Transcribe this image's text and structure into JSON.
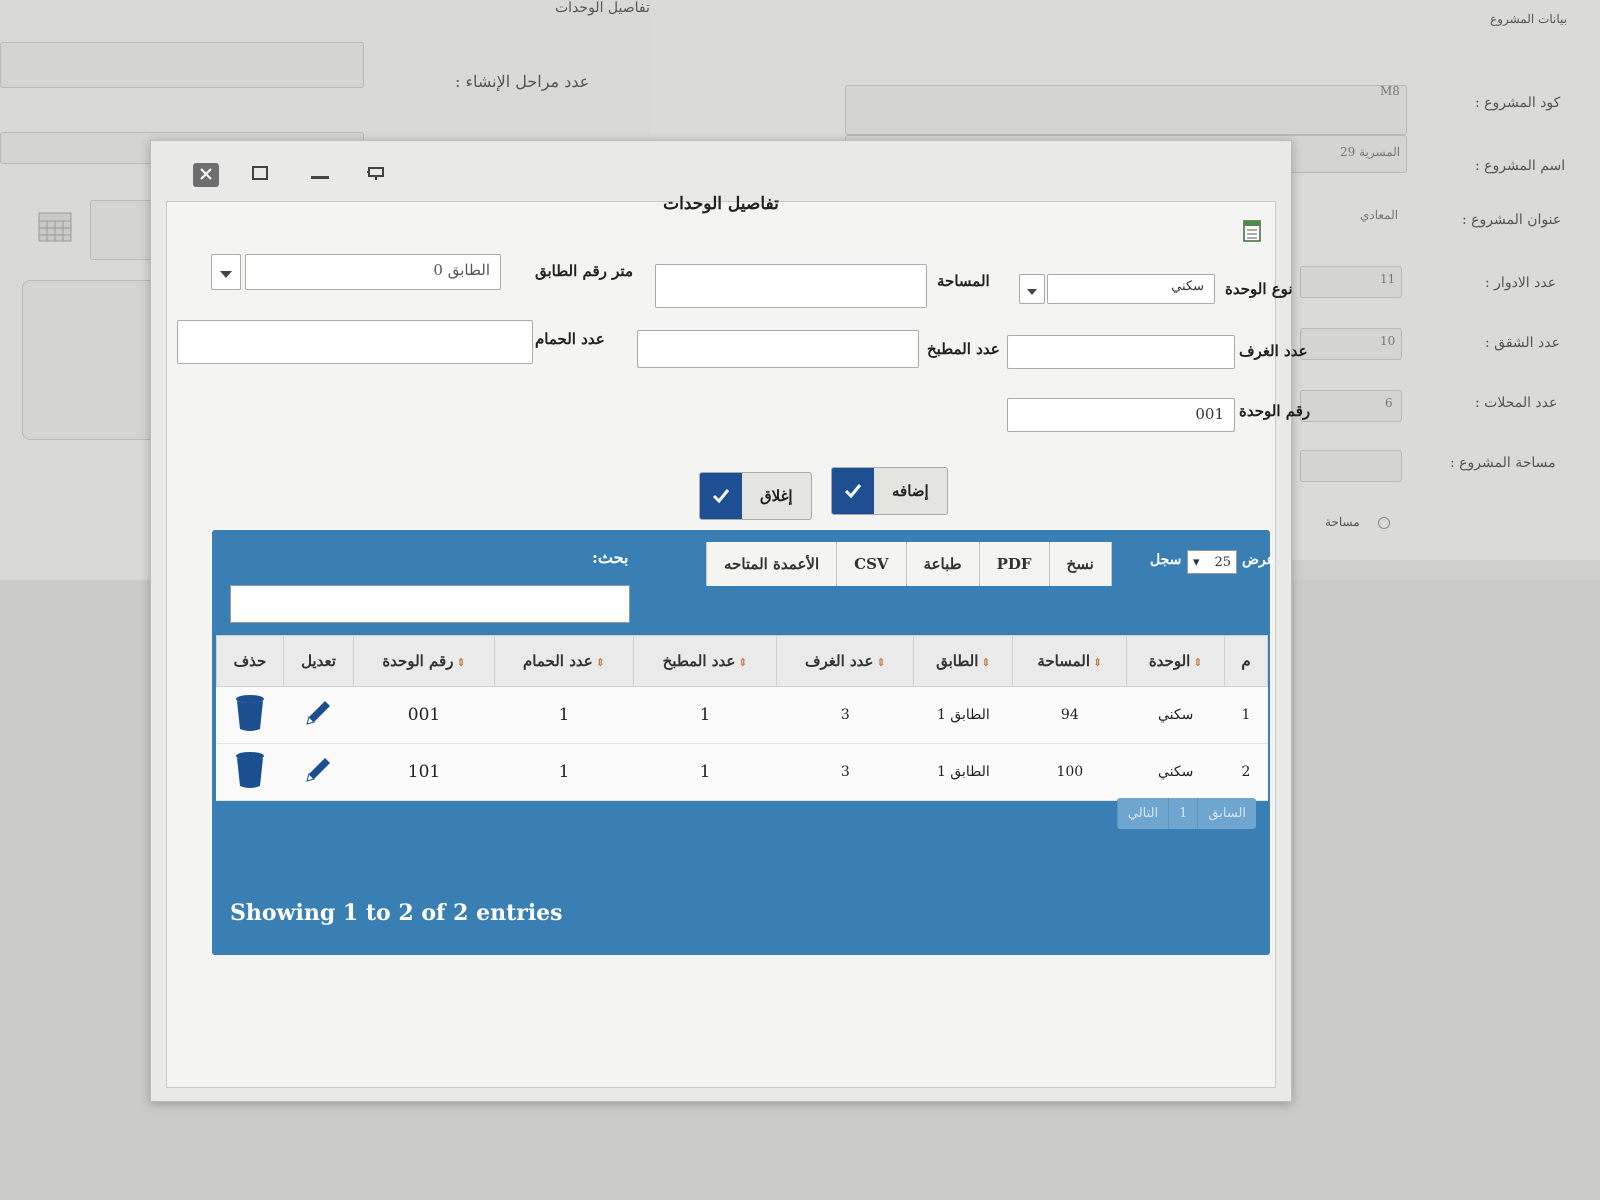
{
  "background": {
    "section_title": "بيانات المشروع",
    "labels": [
      "كود المشروع :",
      "اسم المشروع :",
      "عنوان المشروع :",
      "عدد الادوار :",
      "عدد الشقق :",
      "عدد المحلات :",
      "مساحة المشروع :",
      "عدد مراحل الإنشاء :",
      "تفاصيل الوحدات"
    ],
    "values": {
      "code": "M8",
      "name": "المسرية 29",
      "address": "المعادي",
      "floors": "11",
      "apartments": "10",
      "shops": "6"
    },
    "radio_label": "مساحة"
  },
  "dialog": {
    "title": "تفاصيل الوحدات",
    "fields": {
      "unit_type_label": "نوع الوحدة",
      "unit_type_value": "سكني",
      "area_label": "المساحة",
      "floor_label": "متر رقم الطابق",
      "floor_value": "الطابق 0",
      "rooms_label": "عدد الغرف",
      "kitchens_label": "عدد المطبخ",
      "baths_label": "عدد الحمام",
      "unit_no_label": "رقم الوحدة",
      "unit_no_value": "001"
    },
    "buttons": {
      "add": "إضافه",
      "close": "إغلاق"
    }
  },
  "table": {
    "show_label": "عرض",
    "page_size": "25",
    "records_label": "سجل",
    "toolbar": [
      "نسخ",
      "PDF",
      "طباعة",
      "CSV",
      "الأعمدة المتاحه"
    ],
    "search_label": "بحث:",
    "columns": [
      "م",
      "الوحدة",
      "المساحة",
      "الطابق",
      "عدد الغرف",
      "عدد المطبخ",
      "عدد الحمام",
      "رقم الوحدة",
      "تعديل",
      "حذف"
    ],
    "rows": [
      {
        "n": "1",
        "unit": "سكني",
        "area": "94",
        "floor": "الطابق 1",
        "rooms": "3",
        "kitchens": "1",
        "baths": "1",
        "unit_no": "001"
      },
      {
        "n": "2",
        "unit": "سكني",
        "area": "100",
        "floor": "الطابق 1",
        "rooms": "3",
        "kitchens": "1",
        "baths": "1",
        "unit_no": "101"
      }
    ],
    "pager": {
      "prev": "السابق",
      "page": "1",
      "next": "التالي"
    },
    "info": "Showing 1 to 2 of 2 entries"
  },
  "colors": {
    "panel_blue": "#3a7fb3",
    "check_blue": "#1f4f93",
    "icon_blue": "#1b4f8f"
  }
}
